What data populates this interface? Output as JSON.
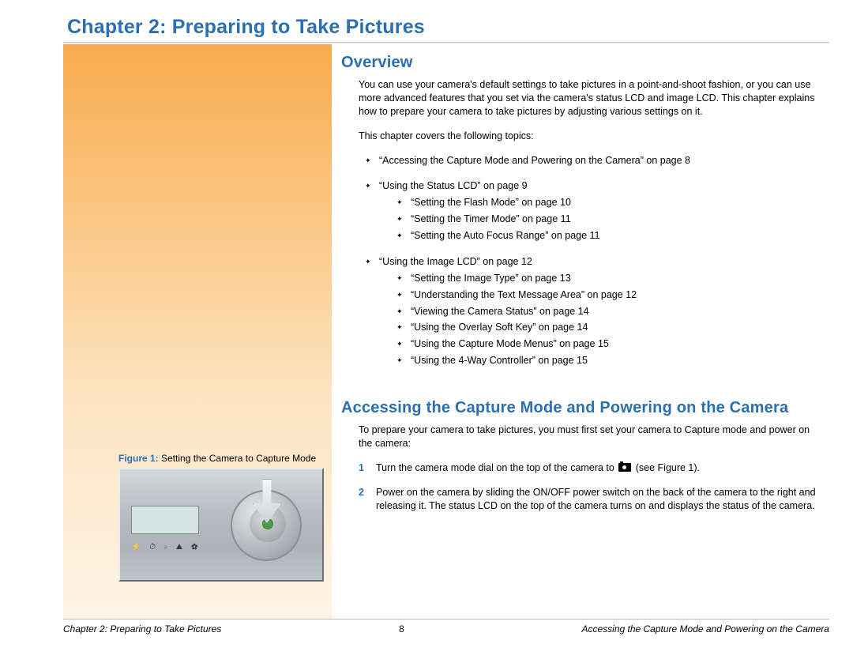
{
  "chapter_title": "Chapter 2: Preparing to Take Pictures",
  "sections": {
    "overview": {
      "heading": "Overview",
      "intro": "You can use your camera's default settings to take pictures in a point-and-shoot fashion, or you can use more advanced features that you set via the camera's status LCD and image LCD. This chapter explains how to prepare your camera to take pictures by adjusting various settings on it.",
      "topics_lead": "This chapter covers the following topics:",
      "topics": [
        {
          "text": "“Accessing the Capture Mode and Powering on the Camera” on page 8"
        },
        {
          "text": "“Using the Status LCD” on page 9",
          "sub": [
            "“Setting the Flash Mode” on page 10",
            "“Setting the Timer Mode” on page 11",
            "“Setting the Auto Focus Range” on page 11"
          ]
        },
        {
          "text": "“Using the Image LCD” on page 12",
          "sub": [
            "“Setting the Image Type” on page 13",
            "“Understanding the Text Message Area” on page 12",
            "“Viewing the Camera Status” on page 14",
            "“Using the Overlay Soft Key” on page 14",
            "“Using the Capture Mode Menus” on page 15",
            "“Using the 4-Way Controller” on page 15"
          ]
        }
      ]
    },
    "accessing": {
      "heading": "Accessing the Capture Mode and Powering on the Camera",
      "intro": "To prepare your camera to take pictures, you must first set your camera to Capture mode and power on the camera:",
      "steps": [
        {
          "num": "1",
          "before": "Turn the camera mode dial on the top of the camera to ",
          "after": " (see Figure 1)."
        },
        {
          "num": "2",
          "text": "Power on the camera by sliding the ON/OFF power switch on the back of the camera to the right and releasing it. The status LCD on the top of the camera turns on and displays the status of the camera."
        }
      ]
    }
  },
  "figure": {
    "label": "Figure 1:",
    "caption": "Setting the Camera to Capture Mode"
  },
  "footer": {
    "left": "Chapter 2: Preparing to Take Pictures",
    "page": "8",
    "right": "Accessing the Capture Mode and Powering on the Camera"
  }
}
